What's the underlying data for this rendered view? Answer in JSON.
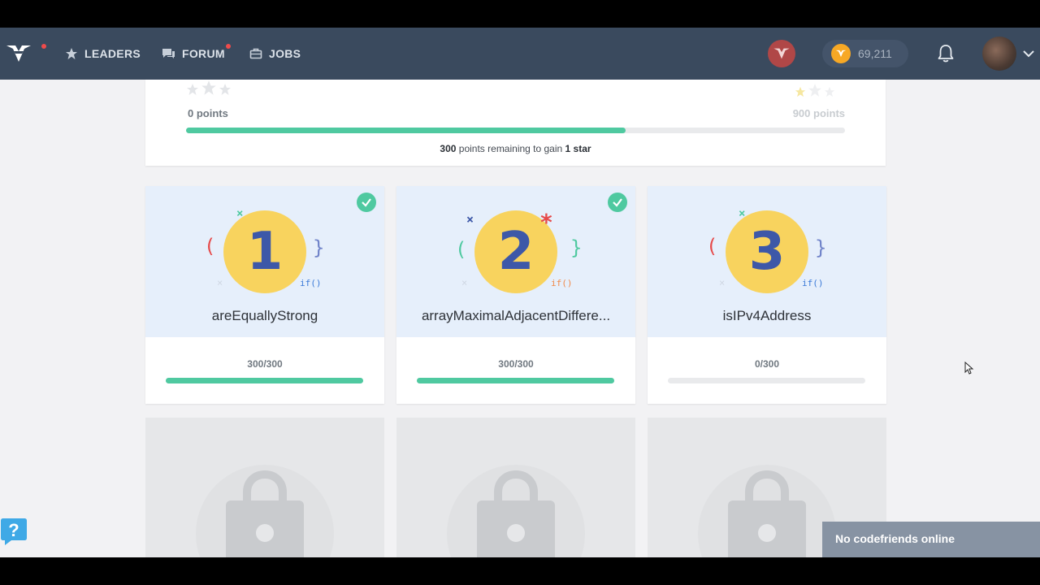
{
  "nav": {
    "logo_icon": "codefights-logo-icon",
    "leaders_label": "LEADERS",
    "forum_label": "FORUM",
    "jobs_label": "JOBS",
    "coins": "69,211",
    "accent": "#3a4a5e",
    "notification_dot_color": "#ef4b4b"
  },
  "progress": {
    "left_points": "0 points",
    "right_points": "900 points",
    "fill_fraction": 0.667,
    "remaining_value": "300",
    "remaining_mid": " points remaining to gain ",
    "remaining_goal": "1 star",
    "bar_color": "#4fc9a0"
  },
  "cards": [
    {
      "number": "1",
      "title": "areEquallyStrong",
      "score": "300/300",
      "progress": 1.0,
      "completed": true
    },
    {
      "number": "2",
      "title": "arrayMaximalAdjacentDiffere...",
      "score": "300/300",
      "progress": 1.0,
      "completed": true
    },
    {
      "number": "3",
      "title": "isIPv4Address",
      "score": "0/300",
      "progress": 0.0,
      "completed": false
    }
  ],
  "deco": {
    "if_text": "if()"
  },
  "locked_cards": [
    {
      "icon": "lock-icon"
    },
    {
      "icon": "lock-icon"
    },
    {
      "icon": "lock-icon"
    }
  ],
  "friends_panel": {
    "label": "No codefriends online"
  },
  "help": {
    "icon": "help-question-icon"
  }
}
